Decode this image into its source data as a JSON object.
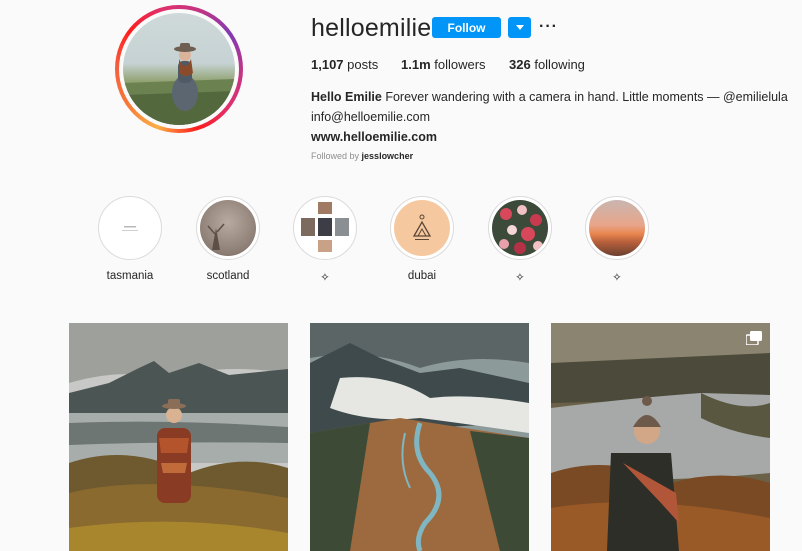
{
  "profile": {
    "username": "helloemilie",
    "follow_label": "Follow",
    "more_label": "···",
    "stats": {
      "posts_value": "1,107",
      "posts_label": "posts",
      "followers_value": "1.1m",
      "followers_label": "followers",
      "following_value": "326",
      "following_label": "following"
    },
    "bio": {
      "name": "Hello Emilie",
      "text": "Forever wandering with a camera in hand. Little moments — @emilielula",
      "email": "info@helloemilie.com",
      "website": "www.helloemilie.com"
    },
    "followed_by_prefix": "Followed by",
    "followed_by_user": "jesslowcher"
  },
  "highlights": [
    {
      "label": "tasmania"
    },
    {
      "label": "scotland"
    },
    {
      "label": "✧"
    },
    {
      "label": "dubai"
    },
    {
      "label": "✧"
    },
    {
      "label": "✧"
    }
  ],
  "colors": {
    "accent": "#0095f6",
    "text": "#262626",
    "muted": "#8e8e8e",
    "background": "#fafafa"
  }
}
